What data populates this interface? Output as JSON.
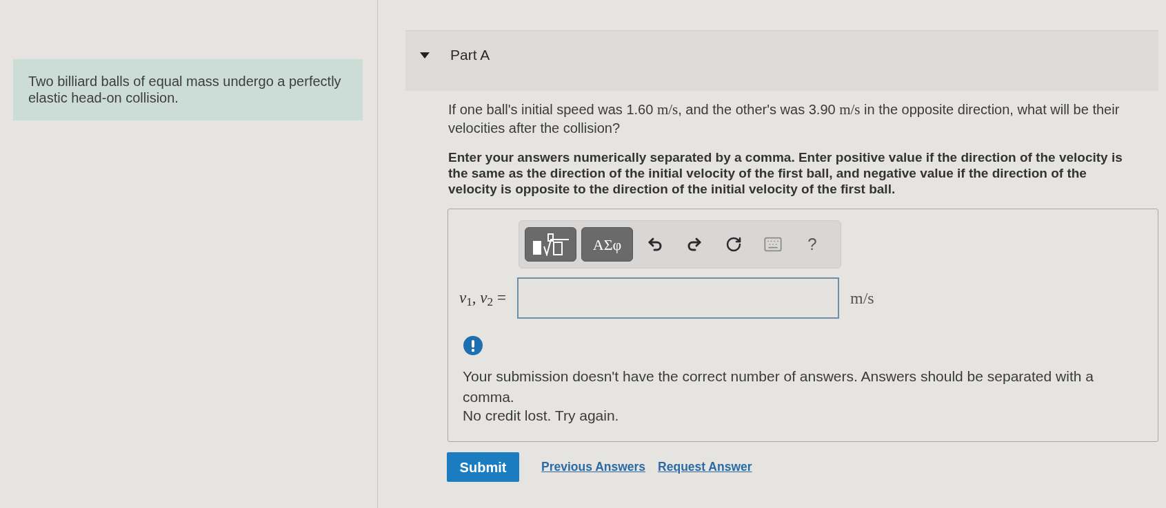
{
  "intro": {
    "text": "Two billiard balls of equal mass undergo a perfectly elastic head-on collision."
  },
  "part": {
    "title": "Part A",
    "expanded": true
  },
  "question": [
    {
      "kind": "text",
      "text": "If one ball's initial speed was 1.60 "
    },
    {
      "kind": "math",
      "text": "m/s"
    },
    {
      "kind": "text",
      "text": ", and the other's was 3.90 "
    },
    {
      "kind": "math",
      "text": "m/s"
    },
    {
      "kind": "text",
      "text": " in the opposite direction, what will be their velocities after the collision?"
    }
  ],
  "instructions": "Enter your answers numerically separated by a comma. Enter positive value if the direction of the velocity is the same as the direction of the initial velocity of the first ball, and negative value if the direction of the velocity is opposite to the direction of the initial velocity of the first ball.",
  "answer": {
    "toolbar": [
      {
        "kind": "templates"
      },
      {
        "kind": "symbols",
        "label": "ΑΣφ"
      },
      {
        "kind": "undo"
      },
      {
        "kind": "redo"
      },
      {
        "kind": "reset"
      },
      {
        "kind": "keyboard"
      },
      {
        "kind": "help",
        "label": "?"
      }
    ],
    "label": "*v*$_{1}$, *v*$_{2}$ =",
    "unit": "m/s"
  },
  "feedback": {
    "kind": "warning",
    "message": "Your submission doesn't have the correct number of answers. Answers should be separated with a comma.",
    "note": "No credit lost. Try again."
  },
  "actions": {
    "submit": "Submit",
    "links": [
      "Previous Answers",
      "Request Answer"
    ]
  }
}
